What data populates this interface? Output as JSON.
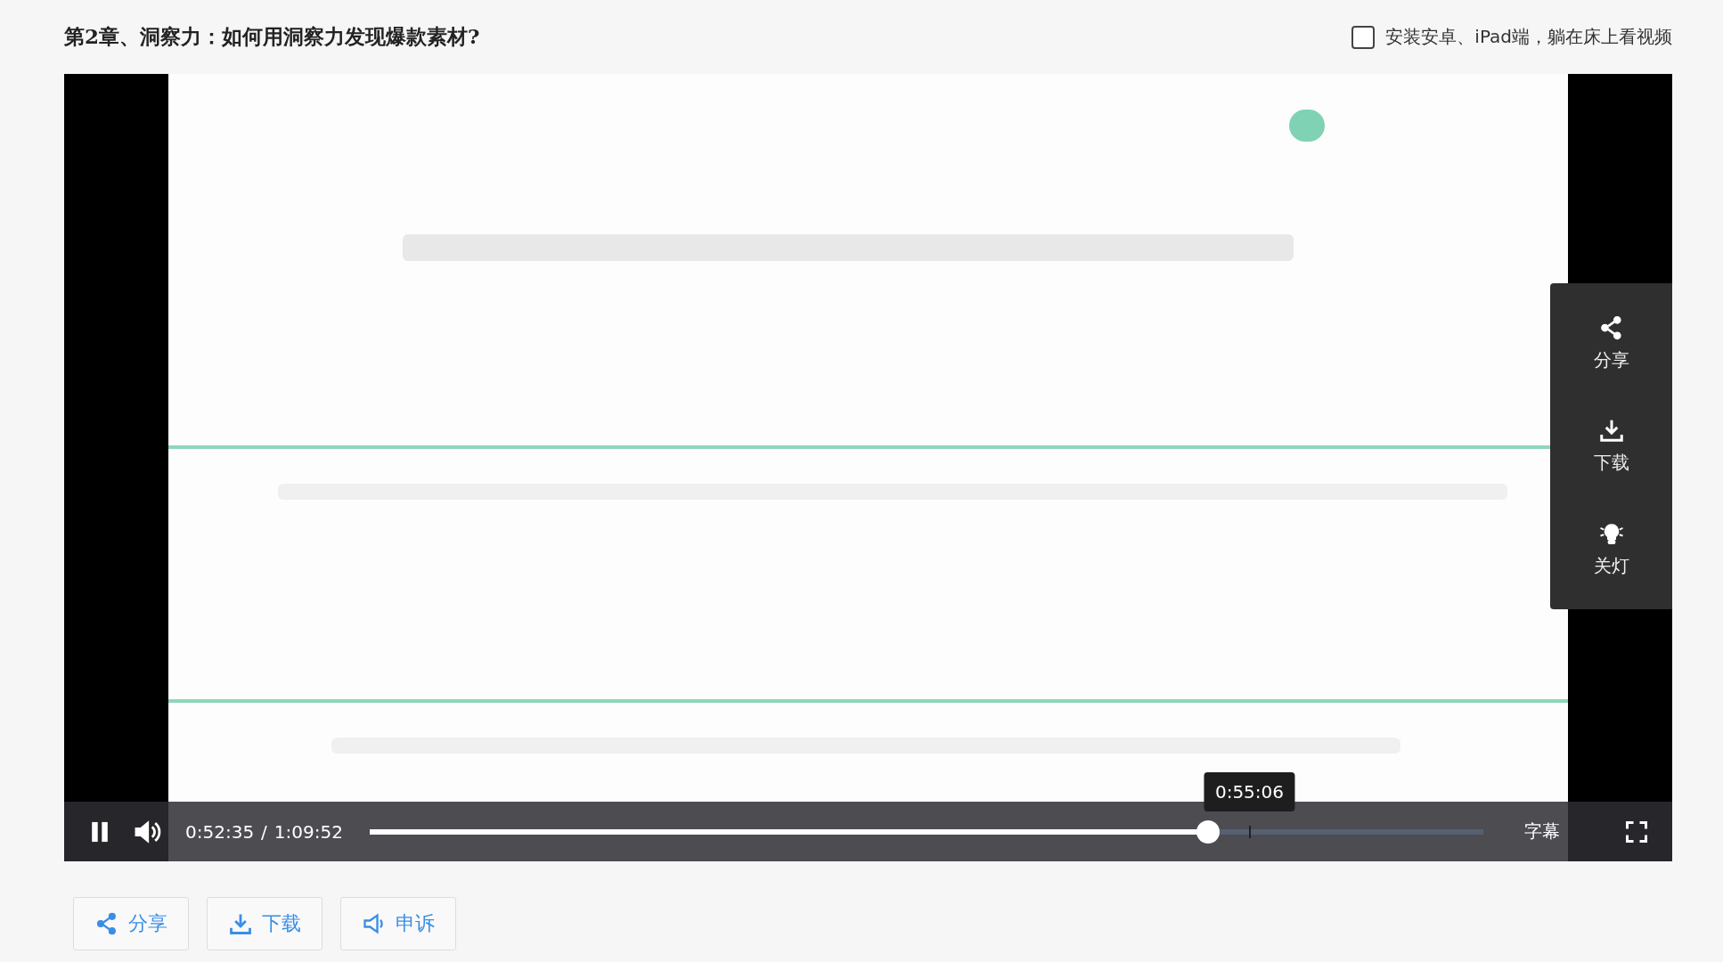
{
  "page": {
    "title": "第2章、洞察力：如何用洞察力发现爆款素材?"
  },
  "app_promo": {
    "checked": false,
    "label": "安装安卓、iPad端，躺在床上看视频"
  },
  "player": {
    "side_menu": [
      {
        "label": "分享",
        "kind": "share"
      },
      {
        "label": "下载",
        "kind": "download"
      },
      {
        "label": "关灯",
        "kind": "light"
      }
    ],
    "controls": {
      "playing": true,
      "current_time": "0:52:35",
      "separator": "/",
      "duration": "1:09:52",
      "progress": {
        "level": 0.753
      },
      "hover_time": "0:55:06",
      "subtitles": "字幕"
    }
  },
  "actions": [
    {
      "label": "分享",
      "kind": "share"
    },
    {
      "label": "下载",
      "kind": "download"
    },
    {
      "label": "申诉",
      "kind": "report"
    }
  ]
}
